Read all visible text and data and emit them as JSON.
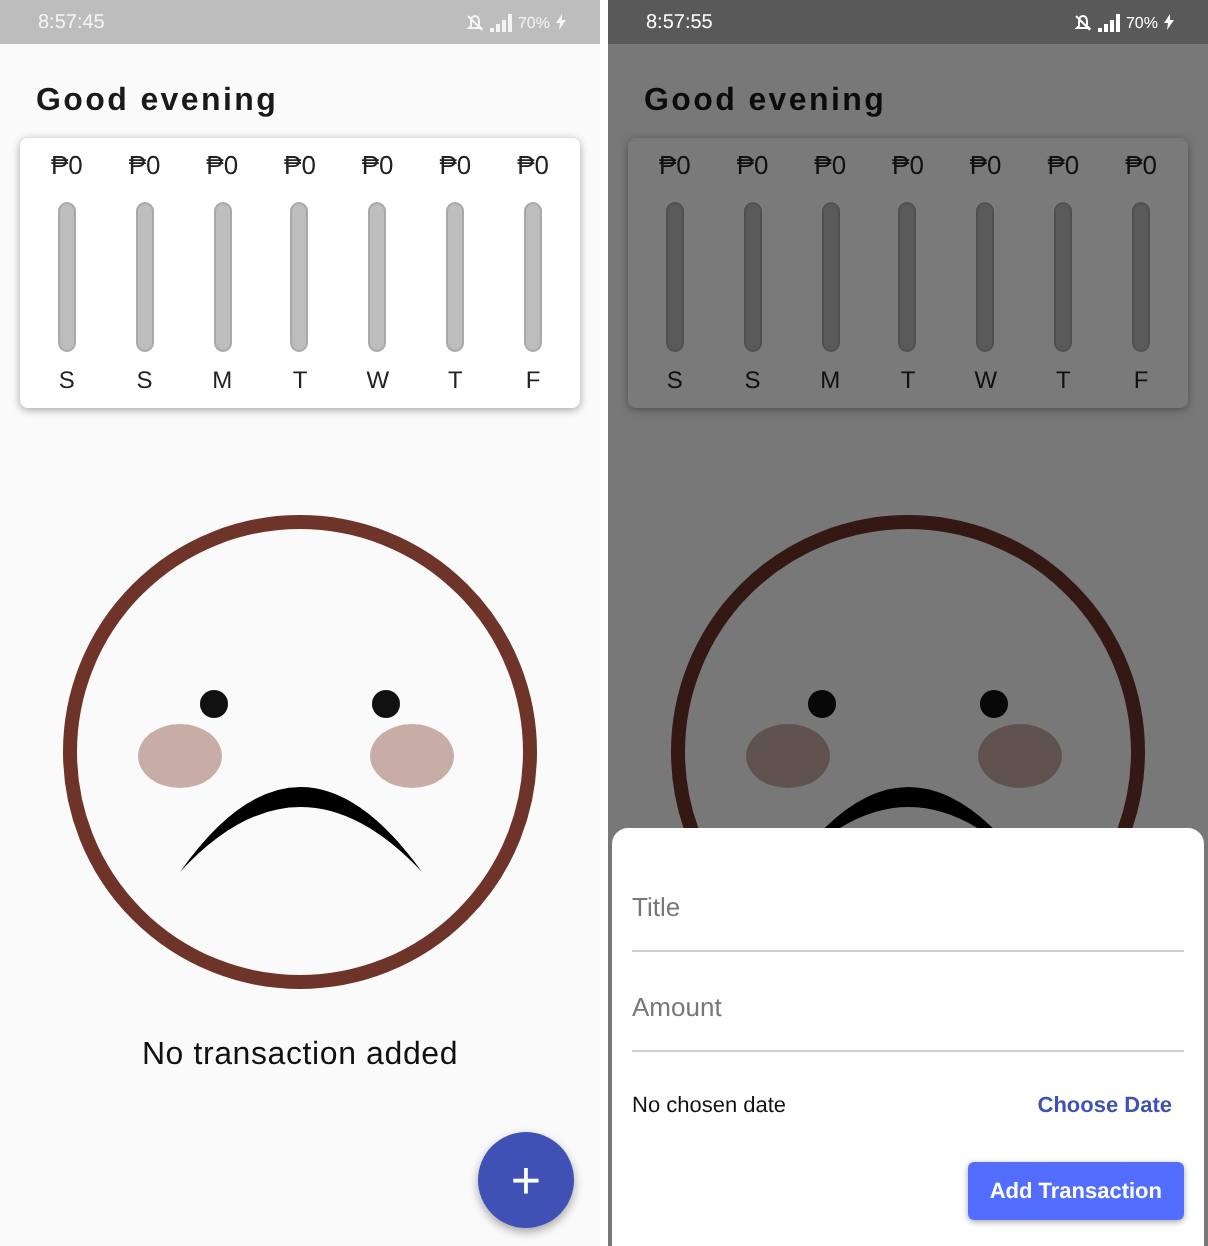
{
  "screens": [
    {
      "status_bar": {
        "time": "8:57:45",
        "battery": "70%"
      },
      "dimmed": false,
      "greeting": "Good evening",
      "week_chart": [
        {
          "amount": "₱0",
          "level": 0,
          "day": "S"
        },
        {
          "amount": "₱0",
          "level": 0,
          "day": "S"
        },
        {
          "amount": "₱0",
          "level": 0,
          "day": "M"
        },
        {
          "amount": "₱0",
          "level": 0,
          "day": "T"
        },
        {
          "amount": "₱0",
          "level": 0,
          "day": "W"
        },
        {
          "amount": "₱0",
          "level": 0,
          "day": "T"
        },
        {
          "amount": "₱0",
          "level": 0,
          "day": "F"
        }
      ],
      "empty_message": "No transaction added",
      "fab": "+"
    },
    {
      "status_bar": {
        "time": "8:57:55",
        "battery": "70%"
      },
      "dimmed": true,
      "greeting": "Good evening",
      "week_chart": [
        {
          "amount": "₱0",
          "level": 0,
          "day": "S"
        },
        {
          "amount": "₱0",
          "level": 0,
          "day": "S"
        },
        {
          "amount": "₱0",
          "level": 0,
          "day": "M"
        },
        {
          "amount": "₱0",
          "level": 0,
          "day": "T"
        },
        {
          "amount": "₱0",
          "level": 0,
          "day": "W"
        },
        {
          "amount": "₱0",
          "level": 0,
          "day": "T"
        },
        {
          "amount": "₱0",
          "level": 0,
          "day": "F"
        }
      ],
      "sheet": {
        "fields": [
          {
            "placeholder": "Title"
          },
          {
            "placeholder": "Amount"
          }
        ],
        "date_label": "No chosen date",
        "date_button": "Choose Date",
        "submit_button": "Add Transaction"
      }
    }
  ]
}
